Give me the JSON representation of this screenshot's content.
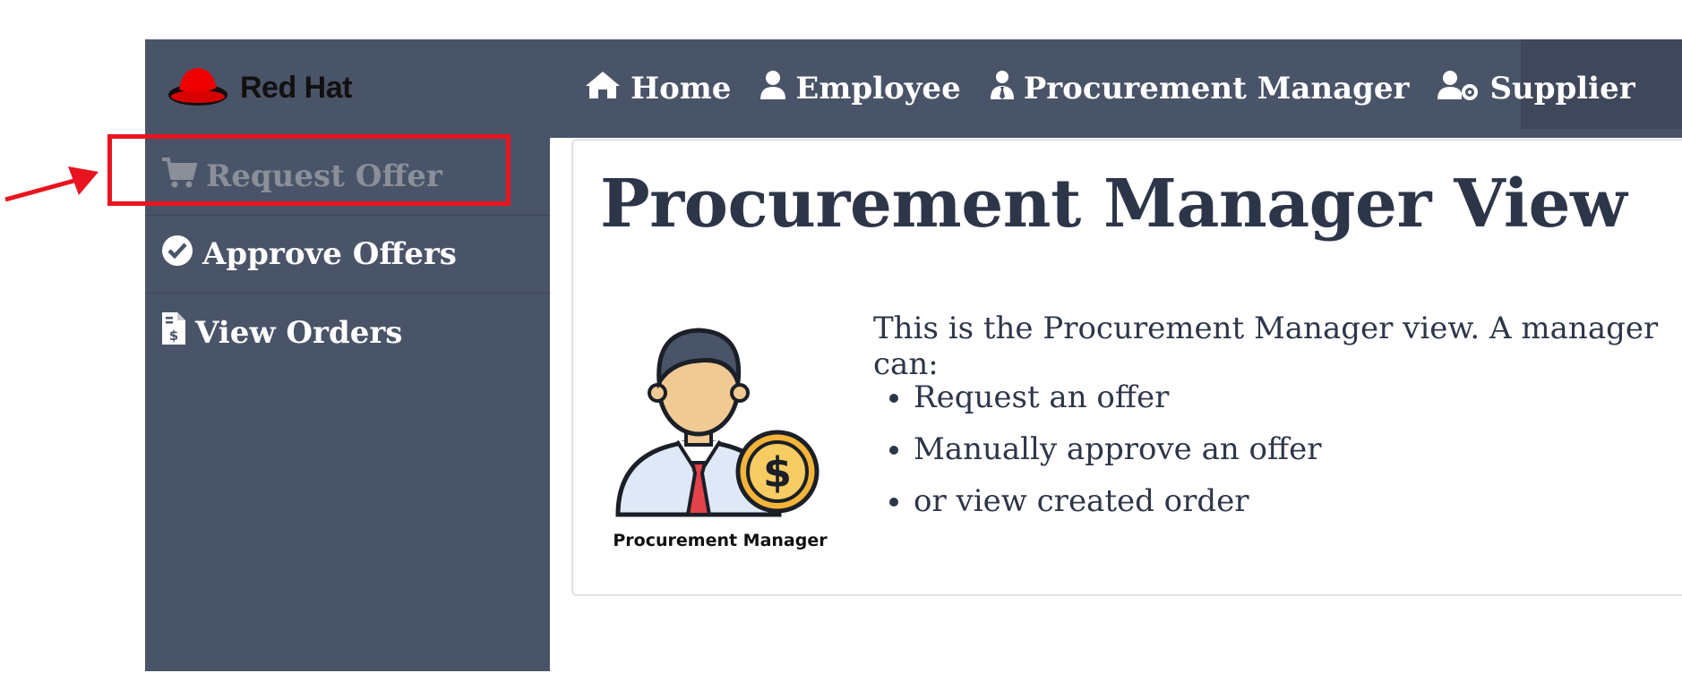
{
  "brand": {
    "name": "Red Hat",
    "logo_icon": "red-hat-fedora-icon"
  },
  "nav": {
    "items": [
      {
        "label": "Home",
        "icon": "home-icon"
      },
      {
        "label": "Employee",
        "icon": "user-icon"
      },
      {
        "label": "Procurement Manager",
        "icon": "user-tie-icon"
      },
      {
        "label": "Supplier",
        "icon": "user-cog-icon"
      }
    ]
  },
  "sidebar": {
    "items": [
      {
        "label": "Request Offer",
        "icon": "shopping-cart-icon",
        "state": "active"
      },
      {
        "label": "Approve Offers",
        "icon": "check-circle-icon"
      },
      {
        "label": "View Orders",
        "icon": "file-invoice-dollar-icon"
      }
    ]
  },
  "main": {
    "title": "Procurement Manager View",
    "image_caption": "Procurement Manager",
    "intro": "This is the Procurement Manager view. A manager can:",
    "bullets": [
      "Request an offer",
      "Manually approve an offer",
      "or view created order"
    ]
  },
  "annotation": {
    "color": "#e8141f"
  },
  "colors": {
    "navbar": "#4a5468",
    "title_text": "#2d3649",
    "active_item": "#8a8f99"
  }
}
